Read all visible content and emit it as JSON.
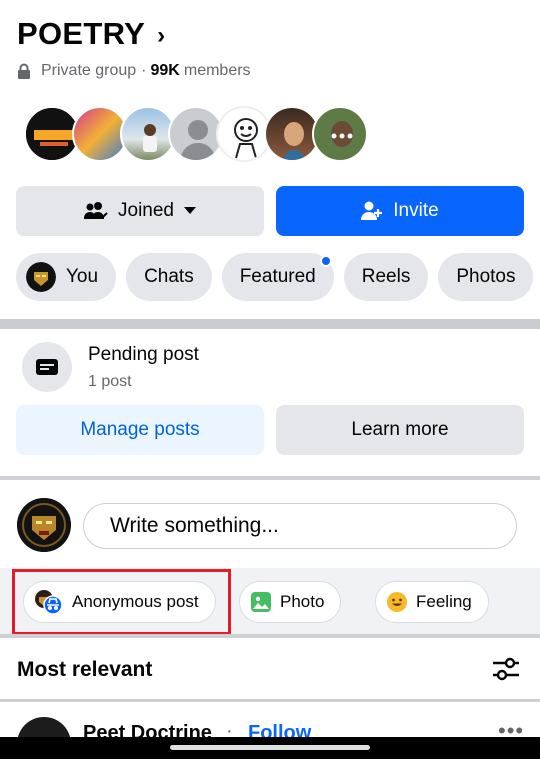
{
  "group": {
    "title": "POETRY",
    "privacy": "Private group",
    "separator": "·",
    "member_count": "99K",
    "members_label": "members"
  },
  "actions": {
    "joined_label": "Joined",
    "invite_label": "Invite"
  },
  "tabs": [
    {
      "label": "You"
    },
    {
      "label": "Chats"
    },
    {
      "label": "Featured"
    },
    {
      "label": "Reels"
    },
    {
      "label": "Photos"
    }
  ],
  "pending": {
    "title": "Pending post",
    "count_text": "1 post",
    "manage_label": "Manage posts",
    "learn_label": "Learn more"
  },
  "composer": {
    "placeholder": "Write something..."
  },
  "composer_chips": [
    {
      "label": "Anonymous post"
    },
    {
      "label": "Photo"
    },
    {
      "label": "Feeling"
    }
  ],
  "feed": {
    "sort_label": "Most relevant",
    "first_post_author": "Peet Doctrine",
    "first_post_separator": "·",
    "follow_label": "Follow",
    "more_label": "•••"
  },
  "colors": {
    "accent": "#0866ff",
    "highlight_box": "#e41e26"
  }
}
